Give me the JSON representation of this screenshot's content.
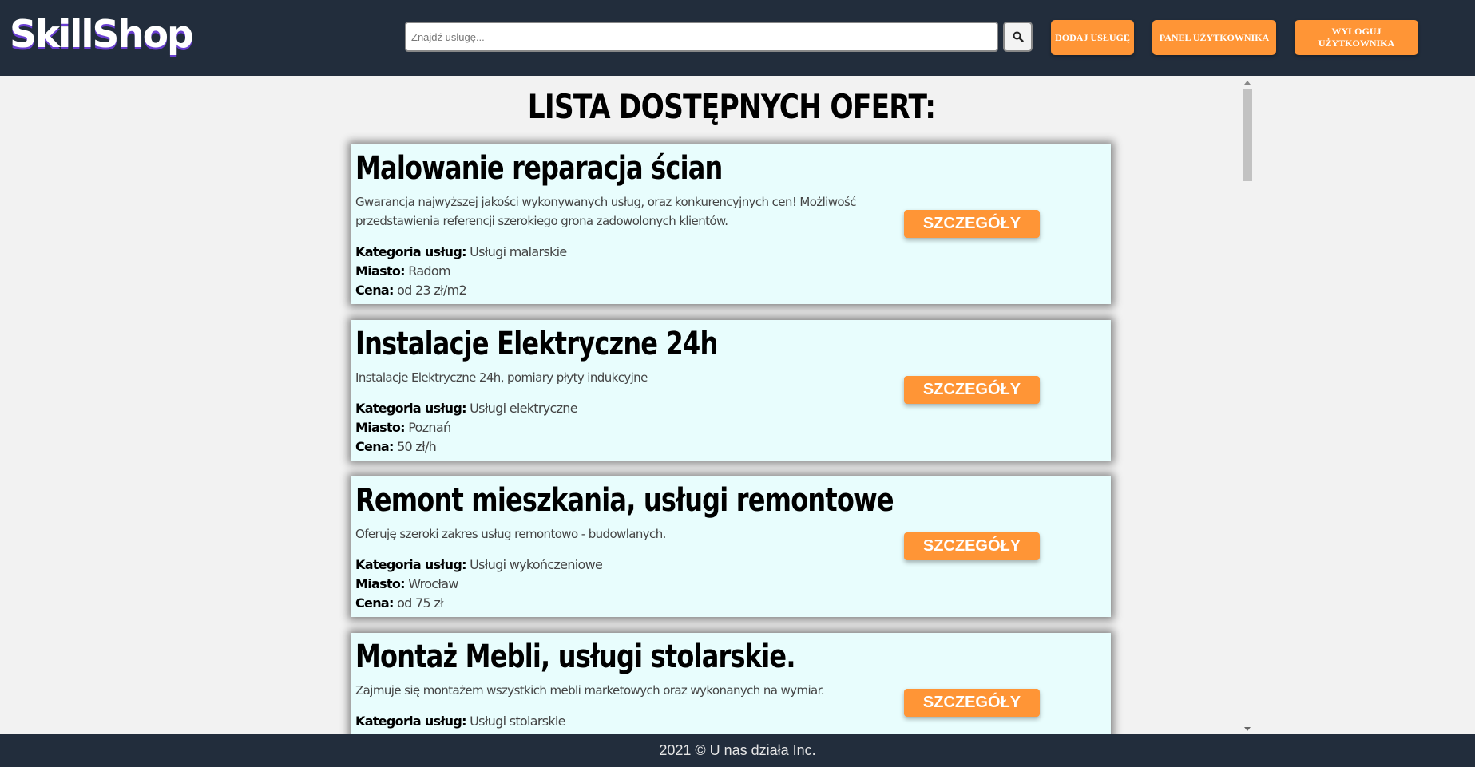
{
  "header": {
    "logo": "SkillShop",
    "search": {
      "placeholder": "Znajdź usługę...",
      "value": ""
    },
    "search_icon": "search-icon",
    "buttons": {
      "add_service": "DODAJ USŁUGĘ",
      "user_panel": "PANEL UŻYTKOWNIKA",
      "logout": "WYLOGUJ UŻYTKOWNIKA"
    }
  },
  "main": {
    "title": "LISTA DOSTĘPNYCH OFERT:",
    "labels": {
      "category": "Kategoria usług:",
      "city": "Miasto:",
      "price": "Cena:"
    },
    "offers": [
      {
        "title": "Malowanie reparacja ścian",
        "description": "Gwarancja najwyższej jakości wykonywanych usług, oraz konkurencyjnych cen! Możliwość przedstawienia referencji szerokiego grona zadowolonych klientów.",
        "category": "Usługi malarskie",
        "city": "Radom",
        "price": "od 23 zł/m2",
        "button": "SZCZEGÓŁY"
      },
      {
        "title": "Instalacje Elektryczne 24h",
        "description": "Instalacje Elektryczne 24h, pomiary płyty indukcyjne",
        "category": "Usługi elektryczne",
        "city": "Poznań",
        "price": "50 zł/h",
        "button": "SZCZEGÓŁY"
      },
      {
        "title": "Remont mieszkania, usługi remontowe",
        "description": "Oferuję szeroki zakres usług remontowo - budowlanych.",
        "category": "Usługi wykończeniowe",
        "city": "Wrocław",
        "price": "od 75 zł",
        "button": "SZCZEGÓŁY"
      },
      {
        "title": "Montaż Mebli, usługi stolarskie.",
        "description": "Zajmuje się montażem wszystkich mebli marketowych oraz wykonanych na wymiar.",
        "category": "Usługi stolarskie",
        "button": "SZCZEGÓŁY"
      }
    ]
  },
  "colors": {
    "navbar": "#222d3c",
    "accent": "#ff9536",
    "card_background": "#e8fdfd",
    "page_background": "#f2f2f2"
  },
  "footer": {
    "text": "2021 © U nas działa Inc."
  }
}
